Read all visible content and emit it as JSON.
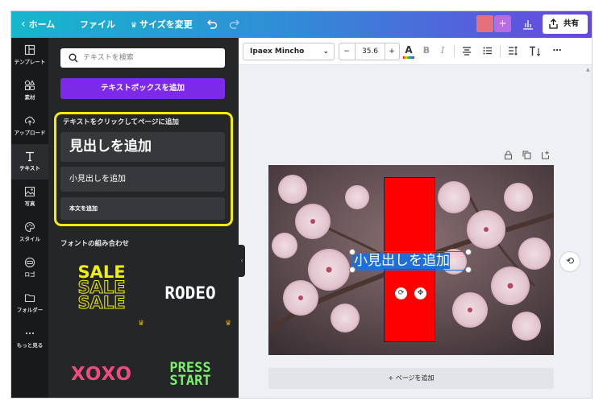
{
  "topbar": {
    "home": "ホーム",
    "file": "ファイル",
    "resize": "サイズを変更",
    "share": "共有"
  },
  "rail": [
    {
      "label": "テンプレート",
      "icon": "template-icon"
    },
    {
      "label": "素材",
      "icon": "elements-icon"
    },
    {
      "label": "アップロード",
      "icon": "upload-icon"
    },
    {
      "label": "テキスト",
      "icon": "text-icon"
    },
    {
      "label": "写真",
      "icon": "photo-icon"
    },
    {
      "label": "スタイル",
      "icon": "palette-icon"
    },
    {
      "label": "ロゴ",
      "icon": "logo-icon"
    },
    {
      "label": "フォルダー",
      "icon": "folder-icon"
    },
    {
      "label": "もっと見る",
      "icon": "more-icon"
    }
  ],
  "panel": {
    "search_placeholder": "テキストを検索",
    "add_textbox": "テキストボックスを追加",
    "click_to_add": "テキストをクリックしてページに追加",
    "add_heading": "見出しを追加",
    "add_subheading": "小見出しを追加",
    "add_body": "本文を追加",
    "font_combos": "フォントの組み合わせ",
    "combos": {
      "sale": "SALE",
      "rodeo": "RODEO",
      "xoxo": "XOXO",
      "press": "PRESS",
      "start": "START"
    }
  },
  "toolbar": {
    "font_name": "Ipaex Mincho",
    "font_size": "35.6",
    "minus": "−",
    "plus": "+"
  },
  "canvas": {
    "text_box": "小見出しを追加",
    "add_page": "+ ページを追加"
  },
  "colors": {
    "accent": "#7d2ae8",
    "highlight": "#f5ec00",
    "red_rect": "#ff0000",
    "selection": "#1f6fd6"
  }
}
